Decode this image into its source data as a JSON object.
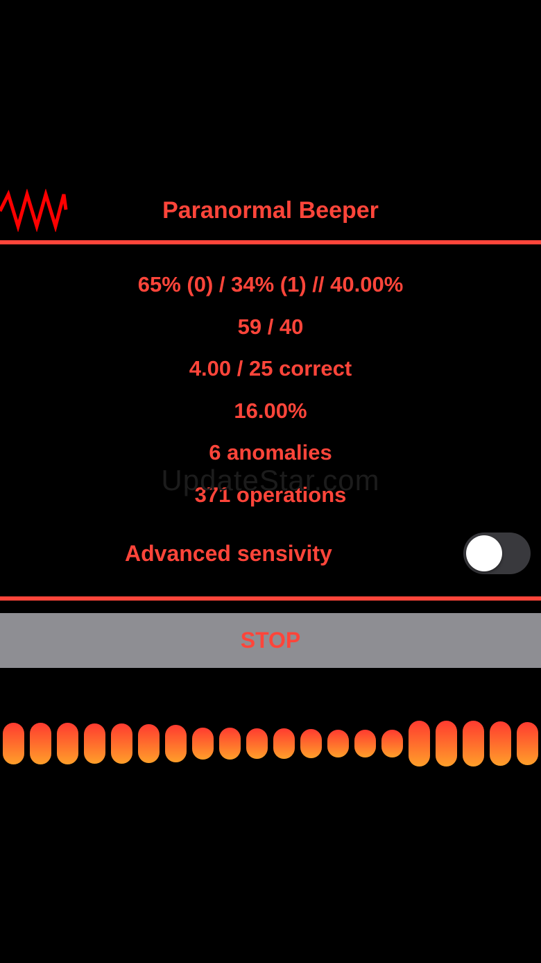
{
  "header": {
    "title": "Paranormal Beeper",
    "logo_icon": "waveform-logo-icon"
  },
  "stats": {
    "lines": [
      "65% (0) / 34% (1) // 40.00%",
      "59 / 40",
      "4.00 / 25 correct",
      "16.00%",
      "6 anomalies",
      "371 operations"
    ]
  },
  "watermark": "UpdateStar.com",
  "settings": {
    "advanced_sensitivity_label": "Advanced sensivity",
    "advanced_sensitivity_on": false
  },
  "controls": {
    "stop_label": "STOP"
  },
  "meter": {
    "levels": [
      0.85,
      0.85,
      0.85,
      0.8,
      0.8,
      0.75,
      0.7,
      0.5,
      0.5,
      0.45,
      0.45,
      0.4,
      0.35,
      0.35,
      0.35,
      1.0,
      1.0,
      1.0,
      0.95,
      0.9
    ]
  },
  "colors": {
    "accent": "#ff453a",
    "background": "#000000",
    "button_background": "#8e8e93",
    "toggle_track_off": "#39393d",
    "meter_gradient_top": "#ff3b30",
    "meter_gradient_bottom": "#ff9f2a"
  }
}
